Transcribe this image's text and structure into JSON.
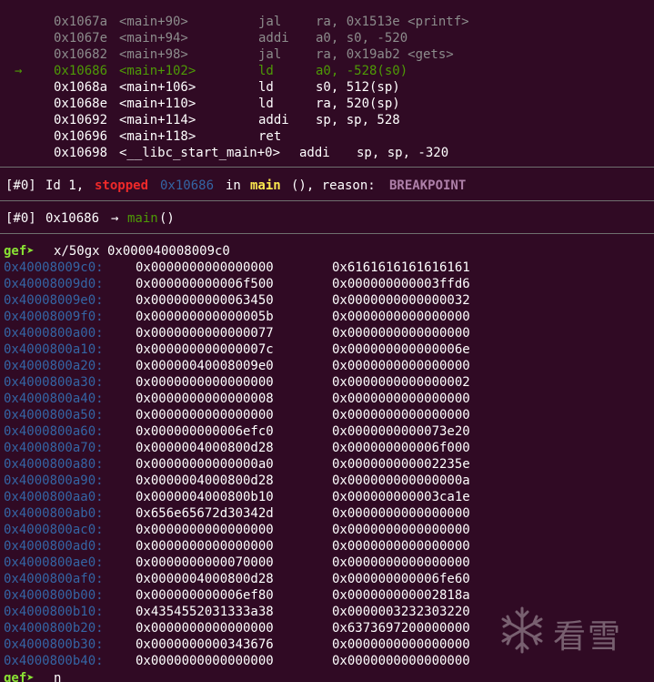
{
  "disasm": [
    {
      "marker": "",
      "addr": "0x1067a",
      "sym": "<main+90>",
      "mnem": "jal",
      "ops": "ra, 0x1513e <printf>",
      "state": "past"
    },
    {
      "marker": "",
      "addr": "0x1067e",
      "sym": "<main+94>",
      "mnem": "addi",
      "ops": "a0, s0, -520",
      "state": "past"
    },
    {
      "marker": "",
      "addr": "0x10682",
      "sym": "<main+98>",
      "mnem": "jal",
      "ops": "ra, 0x19ab2 <gets>",
      "state": "past"
    },
    {
      "marker": "→",
      "addr": "0x10686",
      "sym": "<main+102>",
      "mnem": "ld",
      "ops": "a0, -528(s0)",
      "state": "current"
    },
    {
      "marker": "",
      "addr": "0x1068a",
      "sym": "<main+106>",
      "mnem": "ld",
      "ops": "s0, 512(sp)",
      "state": "future"
    },
    {
      "marker": "",
      "addr": "0x1068e",
      "sym": "<main+110>",
      "mnem": "ld",
      "ops": "ra, 520(sp)",
      "state": "future"
    },
    {
      "marker": "",
      "addr": "0x10692",
      "sym": "<main+114>",
      "mnem": "addi",
      "ops": "sp, sp, 528",
      "state": "future"
    },
    {
      "marker": "",
      "addr": "0x10696",
      "sym": "<main+118>",
      "mnem": "ret",
      "ops": "",
      "state": "future"
    },
    {
      "marker": "",
      "addr": "0x10698",
      "sym": "<__libc_start_main+0>",
      "mnem": "addi",
      "ops": "sp, sp, -320",
      "state": "future"
    }
  ],
  "threads": {
    "tag": "[#0]",
    "id_text": "Id 1,",
    "stopped": "stopped",
    "addr": "0x10686",
    "in_text": "in",
    "func": "main",
    "rest": "(), reason:",
    "reason": "BREAKPOINT"
  },
  "trace": {
    "tag": "[#0]",
    "addr": "0x10686",
    "arrow": "→",
    "func": "main",
    "suffix": "()"
  },
  "prompt": "gef➤",
  "command": "x/50gx 0x000040008009c0",
  "memory": [
    {
      "addr": "0x40008009c0:",
      "v1": "0x0000000000000000",
      "v2": "0x6161616161616161"
    },
    {
      "addr": "0x40008009d0:",
      "v1": "0x000000000006f500",
      "v2": "0x000000000003ffd6"
    },
    {
      "addr": "0x40008009e0:",
      "v1": "0x0000000000063450",
      "v2": "0x0000000000000032"
    },
    {
      "addr": "0x40008009f0:",
      "v1": "0x000000000000005b",
      "v2": "0x0000000000000000"
    },
    {
      "addr": "0x4000800a00:",
      "v1": "0x0000000000000077",
      "v2": "0x0000000000000000"
    },
    {
      "addr": "0x4000800a10:",
      "v1": "0x000000000000007c",
      "v2": "0x000000000000006e"
    },
    {
      "addr": "0x4000800a20:",
      "v1": "0x00000040008009e0",
      "v2": "0x0000000000000000"
    },
    {
      "addr": "0x4000800a30:",
      "v1": "0x0000000000000000",
      "v2": "0x0000000000000002"
    },
    {
      "addr": "0x4000800a40:",
      "v1": "0x0000000000000008",
      "v2": "0x0000000000000000"
    },
    {
      "addr": "0x4000800a50:",
      "v1": "0x0000000000000000",
      "v2": "0x0000000000000000"
    },
    {
      "addr": "0x4000800a60:",
      "v1": "0x000000000006efc0",
      "v2": "0x0000000000073e20"
    },
    {
      "addr": "0x4000800a70:",
      "v1": "0x0000004000800d28",
      "v2": "0x000000000006f000"
    },
    {
      "addr": "0x4000800a80:",
      "v1": "0x00000000000000a0",
      "v2": "0x000000000002235e"
    },
    {
      "addr": "0x4000800a90:",
      "v1": "0x0000004000800d28",
      "v2": "0x000000000000000a"
    },
    {
      "addr": "0x4000800aa0:",
      "v1": "0x0000004000800b10",
      "v2": "0x000000000003ca1e"
    },
    {
      "addr": "0x4000800ab0:",
      "v1": "0x656e65672d30342d",
      "v2": "0x0000000000000000"
    },
    {
      "addr": "0x4000800ac0:",
      "v1": "0x0000000000000000",
      "v2": "0x0000000000000000"
    },
    {
      "addr": "0x4000800ad0:",
      "v1": "0x0000000000000000",
      "v2": "0x0000000000000000"
    },
    {
      "addr": "0x4000800ae0:",
      "v1": "0x0000000000070000",
      "v2": "0x0000000000000000"
    },
    {
      "addr": "0x4000800af0:",
      "v1": "0x0000004000800d28",
      "v2": "0x000000000006fe60"
    },
    {
      "addr": "0x4000800b00:",
      "v1": "0x000000000006ef80",
      "v2": "0x000000000002818a"
    },
    {
      "addr": "0x4000800b10:",
      "v1": "0x4354552031333a38",
      "v2": "0x0000003232303220"
    },
    {
      "addr": "0x4000800b20:",
      "v1": "0x0000000000000000",
      "v2": "0x6373697200000000"
    },
    {
      "addr": "0x4000800b30:",
      "v1": "0x0000000000343676",
      "v2": "0x0000000000000000"
    },
    {
      "addr": "0x4000800b40:",
      "v1": "0x0000000000000000",
      "v2": "0x0000000000000000"
    }
  ],
  "last_command": "n",
  "watermark": {
    "icon": "snowflake-icon",
    "text": "看雪"
  },
  "colors": {
    "background": "#300a24",
    "prompt": "#8ae234",
    "address": "#3465a4",
    "current_line": "#4e9a06",
    "past_line": "#8c8c8c",
    "stopped": "#ef2929",
    "func": "#fce94f",
    "reason": "#ad7fa8",
    "separator": "#6f6f6f"
  }
}
